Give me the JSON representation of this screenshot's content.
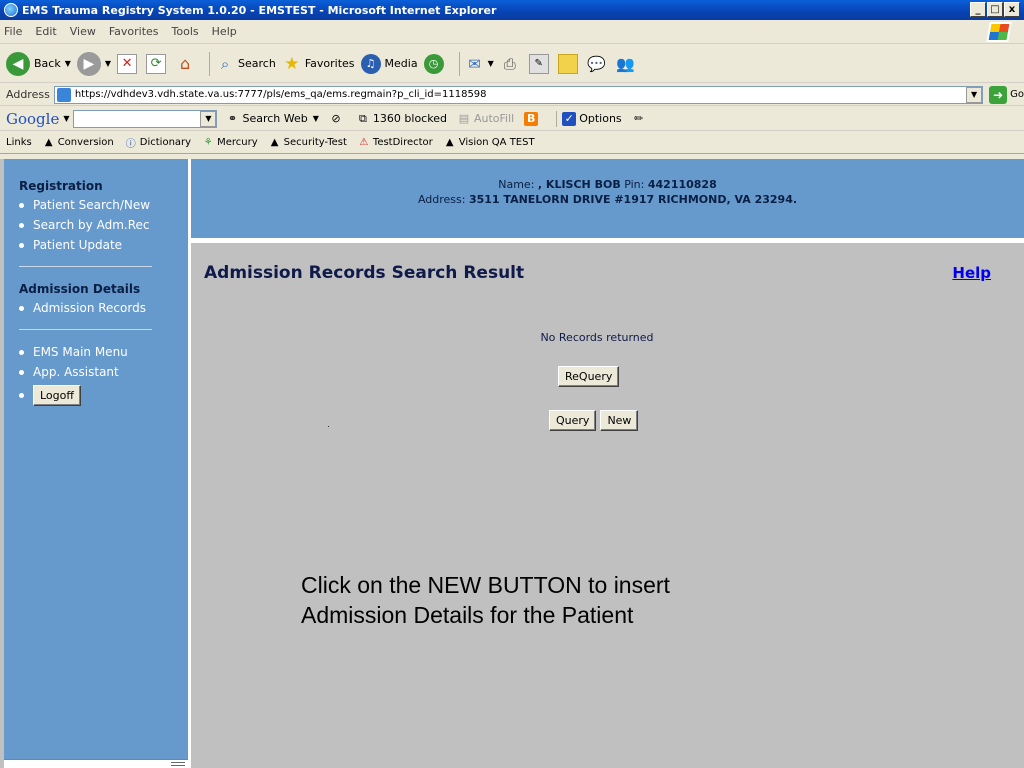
{
  "window": {
    "title": "EMS Trauma Registry System 1.0.20 - EMSTEST - Microsoft Internet Explorer",
    "controls": [
      "_",
      "□",
      "x"
    ]
  },
  "menu": [
    "File",
    "Edit",
    "View",
    "Favorites",
    "Tools",
    "Help"
  ],
  "toolbar": {
    "back": "Back",
    "search": "Search",
    "favorites": "Favorites",
    "media": "Media"
  },
  "address": {
    "label": "Address",
    "url": "https://vdhdev3.vdh.state.va.us:7777/pls/ems_qa/ems.regmain?p_cli_id=1118598",
    "go": "Go"
  },
  "googlebar": {
    "logo": "Google",
    "search_web": "Search Web",
    "blocked": "1360 blocked",
    "autofill": "AutoFill",
    "options": "Options"
  },
  "links": {
    "label": "Links",
    "items": [
      "Conversion",
      "Dictionary",
      "Mercury",
      "Security-Test",
      "TestDirector",
      "Vision QA TEST"
    ]
  },
  "nav": {
    "registration_title": "Registration",
    "registration_items": [
      "Patient Search/New",
      "Search by Adm.Rec",
      "Patient Update"
    ],
    "admission_title": "Admission Details",
    "admission_items": [
      "Admission Records"
    ],
    "other_items": [
      "EMS Main Menu",
      "App. Assistant"
    ],
    "logoff": "Logoff"
  },
  "header": {
    "name_label": "Name:",
    "name_value": ", KLISCH BOB",
    "pin_label": "Pin:",
    "pin_value": "442110828",
    "address_label": "Address:",
    "address_value": "3511 TANELORN DRIVE #1917 RICHMOND, VA 23294."
  },
  "main": {
    "title": "Admission Records Search Result",
    "help": "Help",
    "no_records": "No Records returned",
    "requery": "ReQuery",
    "query": "Query",
    "new": "New"
  },
  "instruction": {
    "line1": "Click on the NEW BUTTON to insert",
    "line2": "Admission Details for the Patient"
  }
}
